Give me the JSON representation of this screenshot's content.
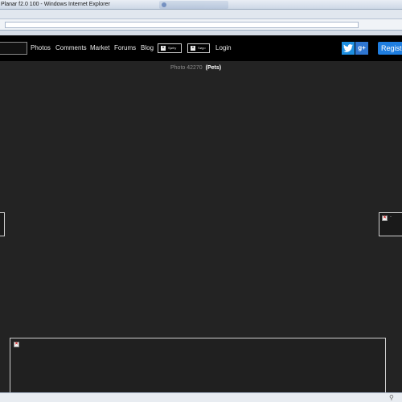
{
  "window": {
    "title": "Planar f2.0 100 - Windows Internet Explorer"
  },
  "site_nav": {
    "links": [
      "Photos",
      "Comments",
      "Market",
      "Forums",
      "Blog"
    ],
    "buttons": [
      {
        "label": "Sjøhy",
        "icon": "broken-image-icon"
      },
      {
        "label": "Søgo",
        "icon": "broken-image-icon"
      }
    ],
    "login": "Login",
    "social": {
      "twitter": "twitter-icon",
      "gplus_label": "g+"
    },
    "register": "Registe"
  },
  "content": {
    "photo_label": "Photo 42270",
    "category": "(Pets)",
    "next_dash": "-"
  },
  "colors": {
    "background": "#232323",
    "nav_bg": "#000000",
    "accent_blue": "#1f7ee0"
  }
}
